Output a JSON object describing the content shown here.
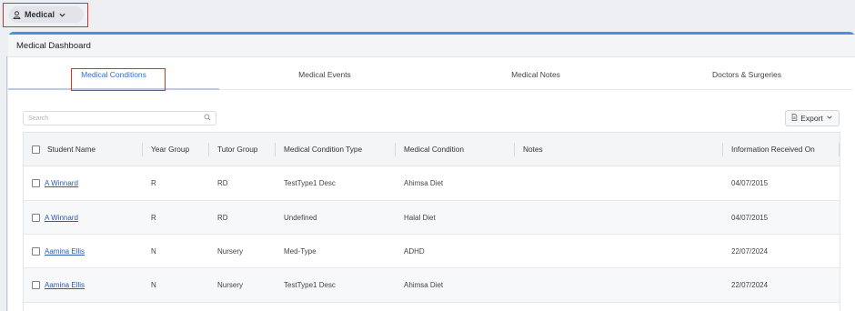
{
  "topbar": {
    "module_label": "Medical",
    "user_icon": "user-icon",
    "chevron_icon": "chevron-down-icon"
  },
  "panel": {
    "title": "Medical Dashboard"
  },
  "tabs": [
    {
      "label": "Medical Conditions",
      "active": true
    },
    {
      "label": "Medical Events",
      "active": false
    },
    {
      "label": "Medical Notes",
      "active": false
    },
    {
      "label": "Doctors & Surgeries",
      "active": false
    }
  ],
  "search": {
    "placeholder": "Search",
    "icon": "search-icon"
  },
  "export": {
    "label": "Export",
    "icon": "document-icon",
    "chevron_icon": "chevron-down-icon"
  },
  "table": {
    "columns": [
      "Student Name",
      "Year Group",
      "Tutor Group",
      "Medical Condition Type",
      "Medical Condition",
      "Notes",
      "Information Received On"
    ],
    "rows": [
      {
        "student": "A Winnard",
        "year": "R",
        "tutor": "RD",
        "type": "TestType1 Desc",
        "condition": "Ahimsa Diet",
        "notes": "",
        "received": "04/07/2015"
      },
      {
        "student": "A Winnard",
        "year": "R",
        "tutor": "RD",
        "type": "Undefined",
        "condition": "Halal Diet",
        "notes": "",
        "received": "04/07/2015"
      },
      {
        "student": "Aamina Ellis",
        "year": "N",
        "tutor": "Nursery",
        "type": "Med-Type",
        "condition": "ADHD",
        "notes": "",
        "received": "22/07/2024"
      },
      {
        "student": "Aamina Ellis",
        "year": "N",
        "tutor": "Nursery",
        "type": "TestType1 Desc",
        "condition": "Ahimsa Diet",
        "notes": "",
        "received": "22/07/2024"
      }
    ]
  },
  "colors": {
    "accent": "#4a90e2",
    "active_tab": "#2f6fd6",
    "link": "#2a5db8",
    "highlight_box": "#e0302a"
  }
}
